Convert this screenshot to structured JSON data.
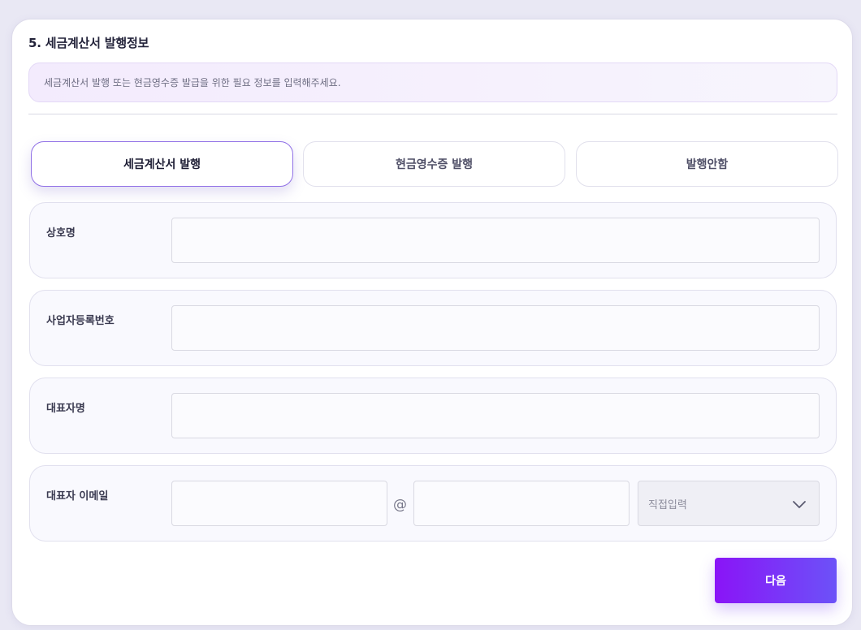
{
  "section": {
    "title": "5. 세금계산서 발행정보",
    "notice": "세금계산서 발행 또는 현금영수증 발급을 위한 필요 정보를 입력해주세요."
  },
  "tabs": [
    {
      "label": "세금계산서 발행",
      "active": true
    },
    {
      "label": "현금영수증 발행",
      "active": false
    },
    {
      "label": "발행안함",
      "active": false
    }
  ],
  "fields": {
    "company_name": {
      "label": "상호명",
      "value": ""
    },
    "business_number": {
      "label": "사업자등록번호",
      "value": ""
    },
    "representative_name": {
      "label": "대표자명",
      "value": ""
    },
    "representative_email": {
      "label": "대표자 이메일",
      "local_value": "",
      "at": "@",
      "domain_value": "",
      "domain_select": "직접입력"
    }
  },
  "buttons": {
    "next": "다음"
  },
  "colors": {
    "accent_start": "#8a14f7",
    "accent_end": "#6c52f8",
    "active_tab_border": "#9070e6"
  }
}
